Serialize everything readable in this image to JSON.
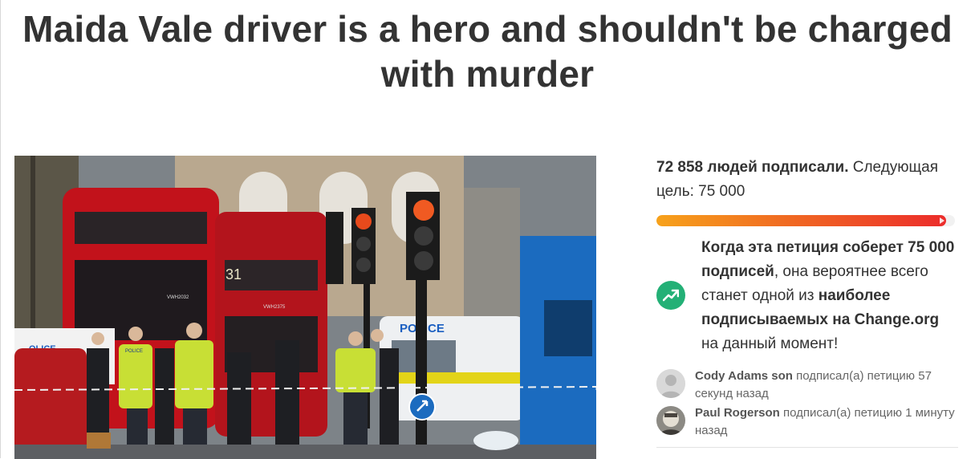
{
  "petition": {
    "title": "Maida Vale driver is a hero and shouldn't be charged with murder"
  },
  "photo": {
    "bus_number": "31",
    "bus_code_1": "VWH2032",
    "bus_code_2": "VWH2375",
    "police_van_text": "POLICE",
    "police_car_text": "OLICE",
    "vest_text": "POLICE"
  },
  "progress": {
    "count_bold": "72 858 людей подписали.",
    "next_goal_text": " Следующая цель: 75 000",
    "signed": 72858,
    "goal": 75000,
    "fill_fraction": 0.97,
    "gradient_start": "#f7a21b",
    "gradient_end": "#ec2c2b"
  },
  "milestone": {
    "icon": "trending-up-icon",
    "icon_color": "#23b076",
    "part1_bold": "Когда эта петиция соберет 75 000 подписей",
    "part2": ", она вероятнее всего станет одной из ",
    "part3_bold": "наиболее подписываемых на Change.org",
    "part4": " на данный момент!"
  },
  "recent_signers": [
    {
      "name": "Cody Adams son",
      "action": " подписал(а) петицию 57 секунд назад",
      "avatar": "default-avatar-icon"
    },
    {
      "name": "Paul Rogerson",
      "action": " подписал(а) петицию 1 минуту назад",
      "avatar": "user-photo-avatar"
    }
  ]
}
